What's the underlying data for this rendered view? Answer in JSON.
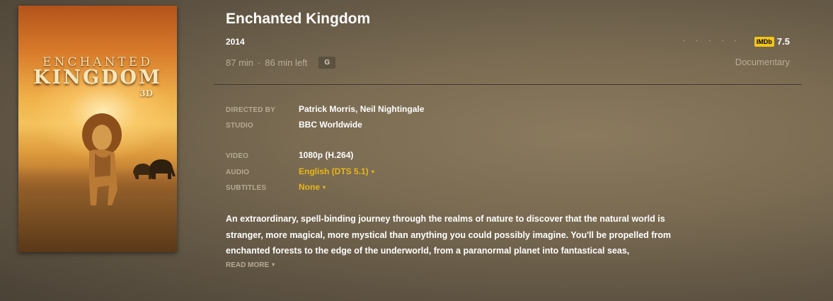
{
  "poster": {
    "line1": "ENCHANTED",
    "line2": "KINGDOM",
    "line3": "3D"
  },
  "movie": {
    "title": "Enchanted Kingdom",
    "year": "2014",
    "duration": "87 min",
    "separator": "·",
    "time_left": "86 min left",
    "content_rating": "G",
    "stars": "· · · · ·",
    "imdb_logo": "IMDb",
    "imdb_score": "7.5",
    "genre": "Documentary"
  },
  "details": {
    "directed_by_label": "DIRECTED BY",
    "directed_by": "Patrick Morris, Neil Nightingale",
    "studio_label": "STUDIO",
    "studio": "BBC Worldwide",
    "video_label": "VIDEO",
    "video": "1080p (H.264)",
    "audio_label": "AUDIO",
    "audio": "English (DTS 5.1)",
    "subtitles_label": "SUBTITLES",
    "subtitles": "None",
    "caret": "▾"
  },
  "summary": {
    "text": "An extraordinary, spell-binding journey through the realms of nature to discover that the natural world is stranger, more magical, more mystical than anything you could possibly imagine. You'll be propelled from enchanted forests to the edge of the underworld, from a paranormal planet into fantastical seas,",
    "read_more": "READ MORE"
  },
  "colors": {
    "accent": "#e8b718",
    "imdb": "#f3c518"
  }
}
